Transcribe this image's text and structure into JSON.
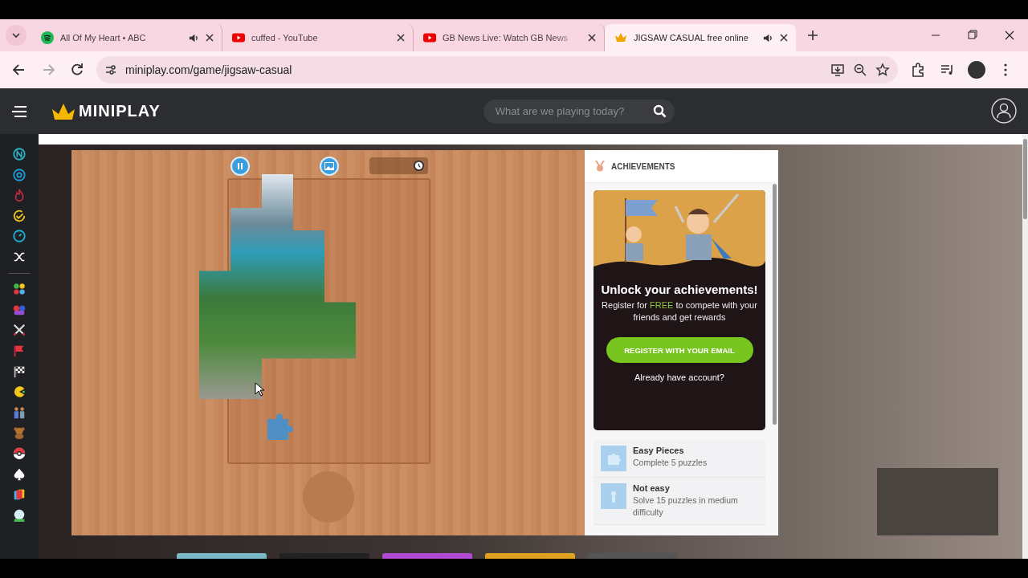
{
  "tabs": [
    {
      "title": "All Of My Heart • ABC",
      "audio": true,
      "selected": false
    },
    {
      "title": "cuffed - YouTube",
      "audio": false,
      "selected": false
    },
    {
      "title": "GB News Live: Watch GB News",
      "audio": false,
      "selected": false
    },
    {
      "title": "JIGSAW CASUAL free online",
      "audio": true,
      "selected": true
    }
  ],
  "address_bar": {
    "url": "miniplay.com/game/jigsaw-casual"
  },
  "site_header": {
    "logo": "MINIPLAY",
    "search": {
      "placeholder": "What are we playing today?"
    }
  },
  "achievements": {
    "heading": "ACHIEVEMENTS",
    "card": {
      "title": "Unlock your achievements!",
      "text": "Register for **FREE** to compete with your friends and get rewards",
      "button": "REGISTER WITH YOUR EMAIL",
      "link": "Already have account?"
    },
    "items": [
      {
        "title": "Easy Pieces",
        "description": "Complete 5 puzzles"
      },
      {
        "title": "Not easy",
        "description": "Solve 15 puzzles in medium difficulty"
      }
    ]
  }
}
